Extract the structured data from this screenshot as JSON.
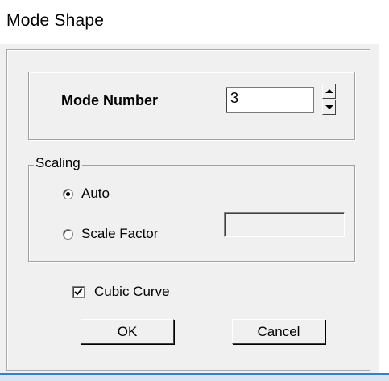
{
  "window": {
    "title": "Mode Shape"
  },
  "mode": {
    "label": "Mode Number",
    "value": "3"
  },
  "scaling": {
    "legend": "Scaling",
    "options": [
      {
        "label": "Auto",
        "selected": true
      },
      {
        "label": "Scale Factor",
        "selected": false
      }
    ],
    "scale_factor_value": ""
  },
  "cubic_curve": {
    "label": "Cubic Curve",
    "checked": true
  },
  "buttons": {
    "ok": "OK",
    "cancel": "Cancel"
  },
  "colors": {
    "dialog_bg": "#f0f0f0",
    "taskbar_accent": "#3c7fc1"
  }
}
